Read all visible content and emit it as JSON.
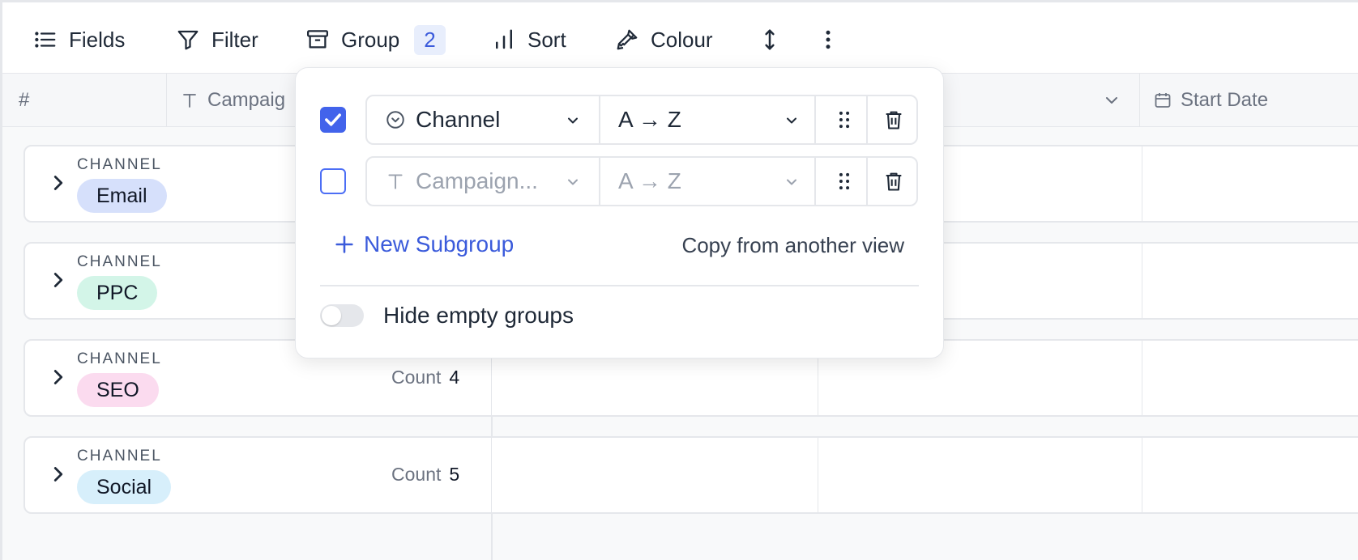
{
  "toolbar": {
    "fields_label": "Fields",
    "filter_label": "Filter",
    "group_label": "Group",
    "group_count": "2",
    "sort_label": "Sort",
    "colour_label": "Colour"
  },
  "header": {
    "index_label": "#",
    "campaign_label": "Campaig",
    "start_date_label": "Start Date"
  },
  "groups": [
    {
      "label": "CHANNEL",
      "value": "Email",
      "color": "#d6e0fb",
      "count_label": "",
      "count": ""
    },
    {
      "label": "CHANNEL",
      "value": "PPC",
      "color": "#d3f5e8",
      "count_label": "",
      "count": ""
    },
    {
      "label": "CHANNEL",
      "value": "SEO",
      "color": "#fbdbef",
      "count_label": "Count",
      "count": "4"
    },
    {
      "label": "CHANNEL",
      "value": "Social",
      "color": "#d7effb",
      "count_label": "Count",
      "count": "5"
    }
  ],
  "popover": {
    "rows": [
      {
        "checked": true,
        "field": "Channel",
        "order": "A → Z"
      },
      {
        "checked": false,
        "field": "Campaign...",
        "order": "A → Z"
      }
    ],
    "new_subgroup": "New Subgroup",
    "copy_from": "Copy from another view",
    "hide_empty": "Hide empty groups"
  },
  "colors": {
    "accent": "#4263eb",
    "border": "#e5e7eb"
  }
}
